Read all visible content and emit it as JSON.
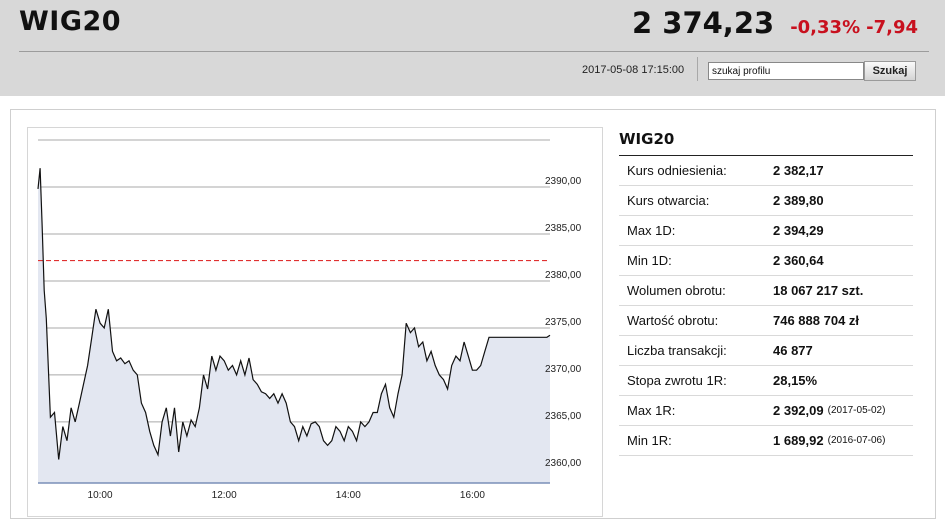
{
  "header": {
    "index_name": "WIG20",
    "price": "2 374,23",
    "change_pct": "-0,33%",
    "change_abs": "-7,94",
    "timestamp": "2017-05-08 17:15:00",
    "search_value": "szukaj profilu",
    "search_button": "Szukaj"
  },
  "colors": {
    "negative": "#c8101e",
    "reference_line": "#e03131",
    "area_fill": "#e3e7f1",
    "price_line": "#111111"
  },
  "stats": {
    "title": "WIG20",
    "rows": [
      {
        "label": "Kurs odniesienia:",
        "value": "2 382,17",
        "date": ""
      },
      {
        "label": "Kurs otwarcia:",
        "value": "2 389,80",
        "date": ""
      },
      {
        "label": "Max 1D:",
        "value": "2 394,29",
        "date": ""
      },
      {
        "label": "Min 1D:",
        "value": "2 360,64",
        "date": ""
      },
      {
        "label": "Wolumen obrotu:",
        "value": "18 067 217 szt.",
        "date": ""
      },
      {
        "label": "Wartość obrotu:",
        "value": "746 888 704 zł",
        "date": ""
      },
      {
        "label": "Liczba transakcji:",
        "value": "46 877",
        "date": ""
      },
      {
        "label": "Stopa zwrotu 1R:",
        "value": "28,15%",
        "date": ""
      },
      {
        "label": "Max 1R:",
        "value": "2 392,09",
        "date": "(2017-05-02)"
      },
      {
        "label": "Min 1R:",
        "value": "1 689,92",
        "date": "(2016-07-06)"
      }
    ]
  },
  "chart_data": {
    "type": "area",
    "title": "",
    "xlabel": "",
    "ylabel": "",
    "ylim": [
      2358.5,
      2395
    ],
    "xlim": [
      "09:00",
      "17:15"
    ],
    "yticks": [
      "2360,00",
      "2365,00",
      "2370,00",
      "2375,00",
      "2380,00",
      "2385,00",
      "2390,00"
    ],
    "xticks": [
      "10:00",
      "12:00",
      "14:00",
      "16:00"
    ],
    "reference_value": 2382.17,
    "grid": true,
    "series": [
      {
        "x": [
          "09:00",
          "09:02",
          "09:04",
          "09:06",
          "09:08",
          "09:12",
          "09:16",
          "09:20",
          "09:24",
          "09:28",
          "09:32",
          "09:36",
          "09:40",
          "09:44",
          "09:48",
          "09:52",
          "09:56",
          "10:00",
          "10:04",
          "10:08",
          "10:12",
          "10:16",
          "10:20",
          "10:24",
          "10:28",
          "10:32",
          "10:36",
          "10:40",
          "10:44",
          "10:48",
          "10:52",
          "10:56",
          "11:00",
          "11:04",
          "11:08",
          "11:12",
          "11:16",
          "11:20",
          "11:24",
          "11:28",
          "11:32",
          "11:36",
          "11:40",
          "11:44",
          "11:48",
          "11:52",
          "11:56",
          "12:00",
          "12:04",
          "12:08",
          "12:12",
          "12:16",
          "12:20",
          "12:24",
          "12:28",
          "12:32",
          "12:36",
          "12:40",
          "12:44",
          "12:48",
          "12:52",
          "12:56",
          "13:00",
          "13:04",
          "13:08",
          "13:12",
          "13:16",
          "13:20",
          "13:24",
          "13:28",
          "13:32",
          "13:36",
          "13:40",
          "13:44",
          "13:48",
          "13:52",
          "13:56",
          "14:00",
          "14:04",
          "14:08",
          "14:12",
          "14:16",
          "14:20",
          "14:24",
          "14:28",
          "14:32",
          "14:36",
          "14:40",
          "14:44",
          "14:48",
          "14:52",
          "14:56",
          "15:00",
          "15:04",
          "15:08",
          "15:12",
          "15:16",
          "15:20",
          "15:24",
          "15:28",
          "15:32",
          "15:36",
          "15:40",
          "15:44",
          "15:48",
          "15:52",
          "15:56",
          "16:00",
          "16:04",
          "16:08",
          "16:12",
          "16:16",
          "16:20",
          "16:24",
          "16:28",
          "16:32",
          "16:36",
          "16:40",
          "16:44",
          "16:48",
          "16:52",
          "16:56",
          "17:00",
          "17:04",
          "17:08",
          "17:12",
          "17:15"
        ],
        "y": [
          2389.8,
          2392.0,
          2386.0,
          2379.0,
          2376.0,
          2365.5,
          2366.0,
          2361.0,
          2364.5,
          2363.0,
          2366.5,
          2365.0,
          2367.0,
          2369.0,
          2371.0,
          2374.0,
          2377.0,
          2375.5,
          2375.0,
          2377.0,
          2372.5,
          2371.5,
          2371.8,
          2371.2,
          2371.5,
          2370.5,
          2370.0,
          2367.0,
          2366.0,
          2364.0,
          2362.5,
          2361.5,
          2365.0,
          2366.5,
          2363.5,
          2366.5,
          2361.8,
          2365.0,
          2363.5,
          2365.2,
          2364.5,
          2366.5,
          2370.0,
          2368.5,
          2372.0,
          2370.5,
          2372.0,
          2371.5,
          2370.5,
          2371.0,
          2370.0,
          2371.5,
          2370.0,
          2371.8,
          2369.5,
          2369.0,
          2368.2,
          2368.0,
          2367.5,
          2368.0,
          2367.0,
          2368.0,
          2367.0,
          2365.0,
          2364.5,
          2363.0,
          2364.5,
          2363.5,
          2364.8,
          2365.0,
          2364.5,
          2363.0,
          2362.5,
          2363.0,
          2364.5,
          2364.0,
          2363.0,
          2364.5,
          2364.0,
          2363.0,
          2365.0,
          2364.5,
          2365.0,
          2366.0,
          2366.0,
          2368.0,
          2369.0,
          2366.5,
          2365.5,
          2368.0,
          2370.0,
          2375.5,
          2374.5,
          2375.0,
          2373.0,
          2373.5,
          2371.5,
          2372.5,
          2371.0,
          2370.0,
          2369.5,
          2368.5,
          2371.0,
          2372.0,
          2371.5,
          2373.5,
          2372.0,
          2370.5,
          2370.5,
          2371.0,
          2372.5,
          2374.0,
          2374.0,
          2374.0,
          2374.0,
          2374.0,
          2374.0,
          2374.0,
          2374.0,
          2374.0,
          2374.0,
          2374.0,
          2374.0,
          2374.0,
          2374.0,
          2374.0,
          2374.23
        ]
      }
    ]
  }
}
